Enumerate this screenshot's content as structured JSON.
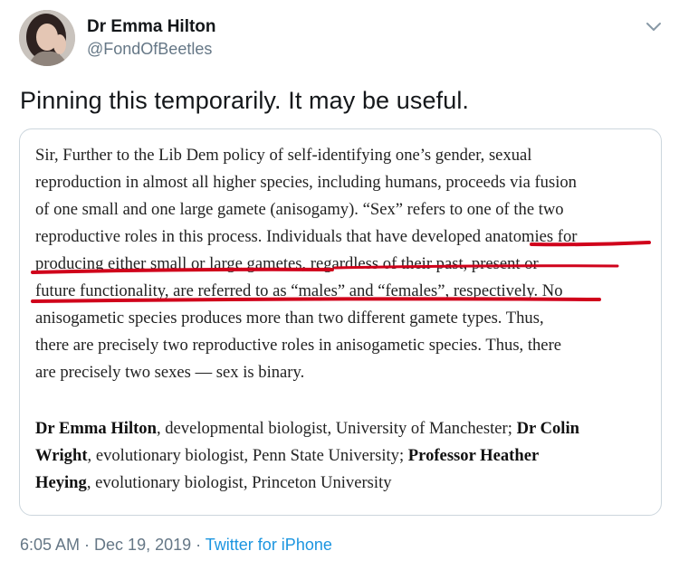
{
  "author": {
    "display_name": "Dr Emma Hilton",
    "handle": "@FondOfBeetles"
  },
  "tweet": {
    "text": "Pinning this temporarily. It may be useful."
  },
  "image_letter": {
    "lines": [
      "Sir, Further to the Lib Dem policy of self-identifying one’s gender, sexual",
      "reproduction in almost all higher species, including humans, proceeds via fusion",
      "of one small and one large gamete (anisogamy). “Sex” refers to one of the two",
      "reproductive roles in this process. Individuals that have developed anatomies for",
      "producing either small or large gametes, regardless of their past, present or",
      "future functionality, are referred to as “males” and “females”, respectively. No",
      "anisogametic species produces more than two different gamete types. Thus,",
      "there are precisely two reproductive roles in anisogametic species. Thus, there",
      "are precisely two sexes — sex is binary."
    ],
    "signatories": {
      "name1": "Dr Emma Hilton",
      "text1": ", developmental biologist, University of Manchester; ",
      "name2a": "Dr Colin",
      "name2b": "Wright",
      "text2": ", evolutionary biologist, Penn State University; ",
      "name3a": "Professor Heather",
      "name3b": "Heying",
      "text3": ", evolutionary biologist, Princeton University"
    },
    "underline_color": "#d0021b"
  },
  "meta": {
    "time": "6:05 AM",
    "separator1": " · ",
    "date": "Dec 19, 2019",
    "separator2": " · ",
    "source": "Twitter for iPhone",
    "link_color": "#1b95e0"
  },
  "icons": {
    "caret": "chevron-down-icon"
  }
}
